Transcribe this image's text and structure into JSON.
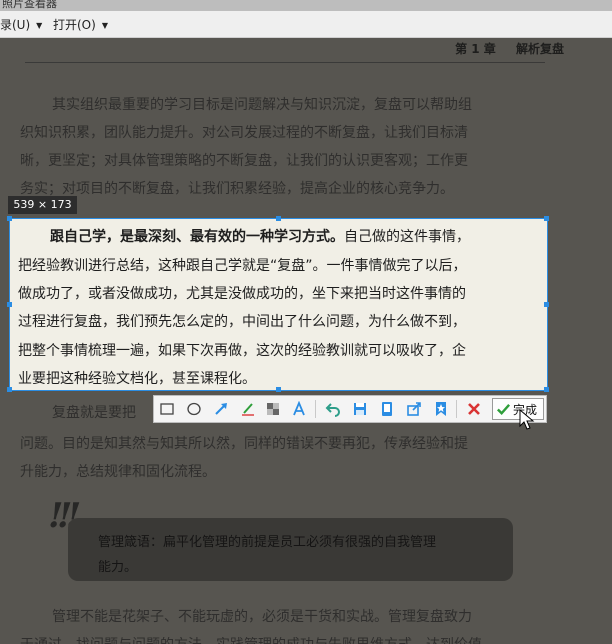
{
  "window": {
    "title": "照片查看器"
  },
  "menu": [
    {
      "label": "录(U)"
    },
    {
      "label": "打开(O)"
    }
  ],
  "page": {
    "chapter_num": "第 1 章",
    "chapter_title": "解析复盘",
    "paragraph1": [
      "其实组织最重要的学习目标是问题解决与知识沉淀，复盘可以帮助组",
      "织知识积累，团队能力提升。对公司发展过程的不断复盘，让我们目标清",
      "晰，更坚定；对具体管理策略的不断复盘，让我们的认识更客观；工作更",
      "务实；对项目的不断复盘，让我们积累经验，提高企业的核心竞争力。"
    ],
    "paragraph2": [
      "复盘就是要把",
      "问题。目的是知其然与知其所以然，同样的错误不要再犯，传承经验和提",
      "升能力，总结规律和固化流程。"
    ],
    "tip": [
      "管理箴语：扁平化管理的前提是员工必须有很强的自我管理",
      "能力。"
    ],
    "paragraph3": [
      "管理不能是花架子、不能玩虚的，必须是干货和实战。管理复盘致力",
      "于通过，找问题与问题的方法，实践管理的成功与失败思维方式，达到价值"
    ]
  },
  "selection": {
    "size_label": "539 × 173",
    "bold_lead": "跟自己学，是最深刻、最有效的一种学习方式。",
    "lines": [
      "自己做的这件事情，",
      "把经验教训进行总结，这种跟自己学就是“复盘”。一件事情做完了以后，",
      "做成功了，或者没做成功，尤其是没做成功的，坐下来把当时这件事情的",
      "过程进行复盘，我们预先怎么定的，中间出了什么问题，为什么做不到，",
      "把整个事情梳理一遍，如果下次再做，这次的经验教训就可以吸收了，企",
      "业要把这种经验文档化，甚至课程化。"
    ]
  },
  "toolbar": {
    "done_label": "完成",
    "accent": "#2b8de3",
    "tools": [
      "rectangle-icon",
      "ellipse-icon",
      "arrow-icon",
      "pen-icon",
      "mosaic-icon",
      "text-icon",
      "undo-icon",
      "save-icon",
      "pin-icon",
      "share-icon",
      "bookmark-icon",
      "cancel-icon",
      "check-icon"
    ]
  }
}
